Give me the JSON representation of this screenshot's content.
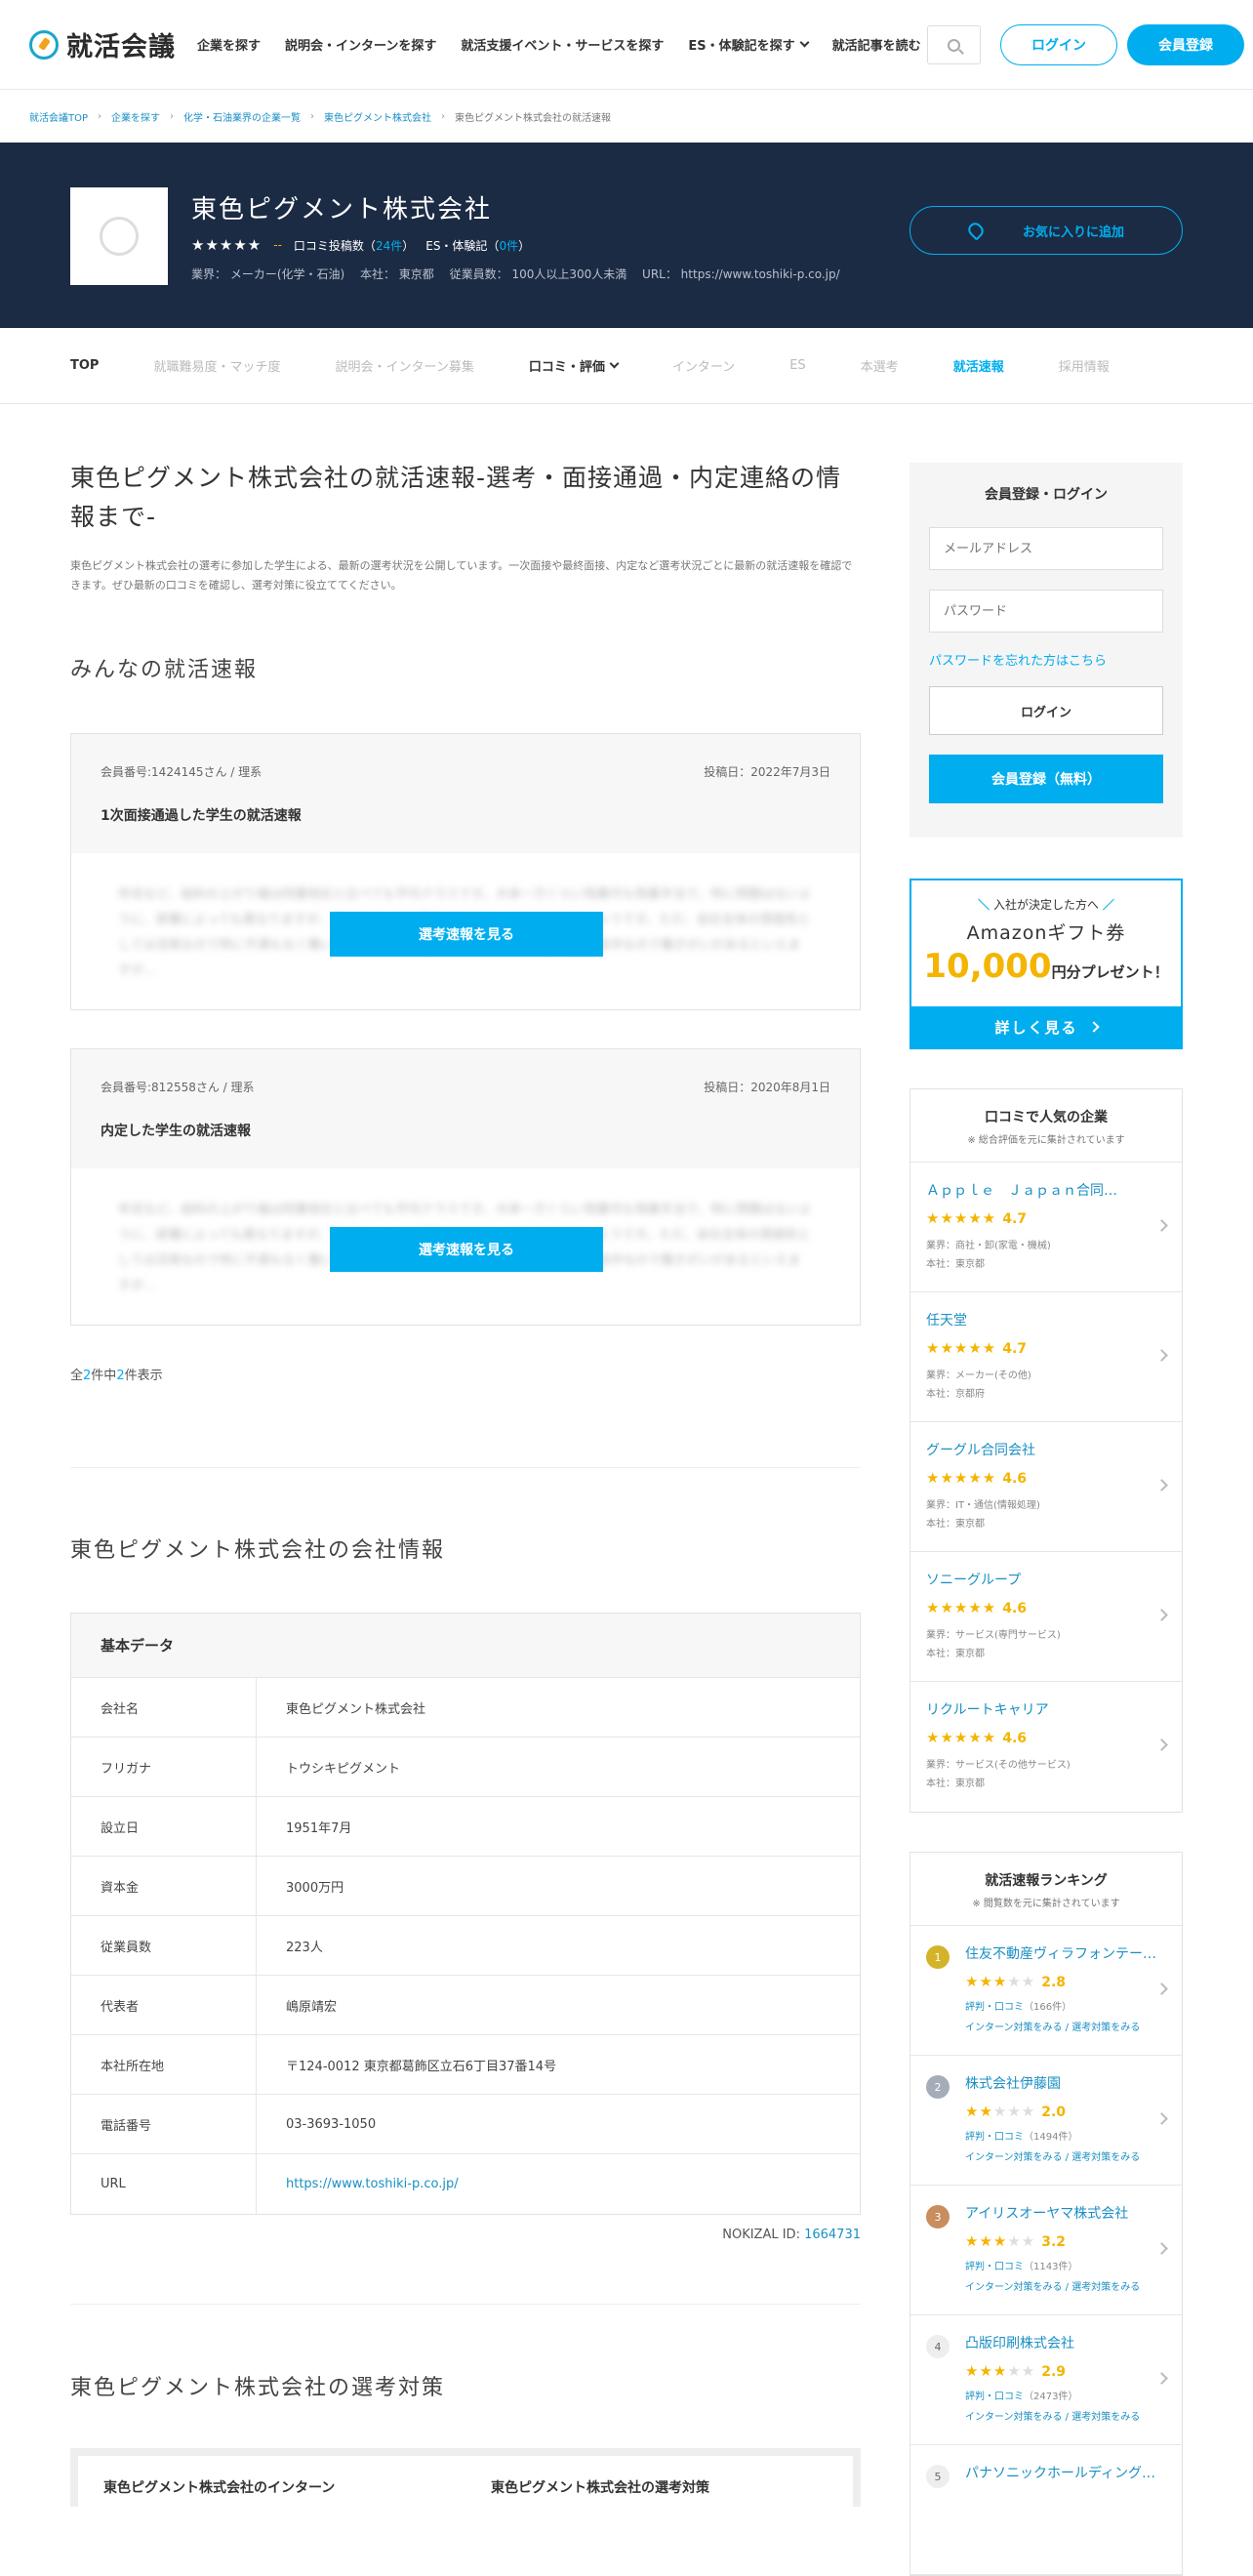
{
  "header": {
    "logo": "就活会議",
    "nav": [
      "企業を探す",
      "説明会・インターンを探す",
      "就活支援イベント・サービスを探す",
      "ES・体験記を探す",
      "就活記事を読む"
    ],
    "login": "ログイン",
    "register": "会員登録"
  },
  "breadcrumb": [
    "就活会議TOP",
    "企業を探す",
    "化学・石油業界の企業一覧",
    "東色ピグメント株式会社",
    "東色ピグメント株式会社の就活速報"
  ],
  "company": {
    "name": "東色ピグメント株式会社",
    "rating": "--",
    "reviews_label": "口コミ投稿数（",
    "reviews_count": "24件",
    "reviews_close": "）",
    "es_label": "ES・体験記（",
    "es_count": "0件",
    "es_close": "）",
    "info": "業界： メーカー(化学・石油)　 本社： 東京都　 従業員数： 100人以上300人未満　 URL： https://www.toshiki-p.co.jp/",
    "fav": "お気に入りに追加"
  },
  "tabs": [
    "TOP",
    "就職難易度・マッチ度",
    "説明会・インターン募集",
    "口コミ・評価",
    "インターン",
    "ES",
    "本選考",
    "就活速報",
    "採用情報"
  ],
  "page": {
    "title": "東色ピグメント株式会社の就活速報-選考・面接通過・内定連絡の情報まで-",
    "intro": "東色ピグメント株式会社の選考に参加した学生による、最新の選考状況を公開しています。一次面接や最終面接、内定など選考状況ごとに最新の就活速報を確認できます。ぜひ最新の口コミを確認し、選考対策に役立ててください。",
    "section1": "みんなの就活速報",
    "blur_text": "年収など、給料の上がり幅は同業他社と比べても平均クラスです。大体一万くらい残業代も残業手当で、特に問題はないように、部署によっても異なりますが、自分のペースで昇給できるというわけではないようです。ただ、会社全体の雰囲気としては活発なので特に不満もなく働いております。またスタートアップで事業も急成長中なので働きがいがあるといえますが…",
    "view_btn": "選考速報を見る",
    "count_prefix": "全",
    "count_total": "2",
    "count_mid": "件中",
    "count_shown": "2",
    "count_suffix": "件表示",
    "section2": "東色ピグメント株式会社の会社情報",
    "section3": "東色ピグメント株式会社の選考対策",
    "nokizal_label": "NOKIZAL ID:",
    "nokizal_id": "1664731",
    "box_left": "東色ピグメント株式会社のインターン",
    "box_right": "東色ピグメント株式会社の選考対策"
  },
  "reports": [
    {
      "member": "会員番号:1424145さん / 理系",
      "date": "投稿日：2022年7月3日",
      "title": "1次面接通過した学生の就活速報"
    },
    {
      "member": "会員番号:812558さん / 理系",
      "date": "投稿日：2020年8月1日",
      "title": "内定した学生の就活速報"
    }
  ],
  "basic": {
    "heading": "基本データ",
    "rows": [
      {
        "k": "会社名",
        "v": "東色ピグメント株式会社"
      },
      {
        "k": "フリガナ",
        "v": "トウシキピグメント"
      },
      {
        "k": "設立日",
        "v": "1951年7月"
      },
      {
        "k": "資本金",
        "v": "3000万円"
      },
      {
        "k": "従業員数",
        "v": "223人"
      },
      {
        "k": "代表者",
        "v": "嶋原靖宏"
      },
      {
        "k": "本社所在地",
        "v": "〒124-0012 東京都葛飾区立石6丁目37番14号"
      },
      {
        "k": "電話番号",
        "v": "03-3693-1050"
      },
      {
        "k": "URL",
        "v": "https://www.toshiki-p.co.jp/"
      }
    ]
  },
  "login_box": {
    "title": "会員登録・ログイン",
    "email_ph": "メールアドレス",
    "pw_ph": "パスワード",
    "forgot": "パスワードを忘れた方はこちら",
    "login": "ログイン",
    "register": "会員登録（無料）"
  },
  "amazon": {
    "top": "入社が決定した方へ",
    "main": "Amazonギフト券",
    "price": "10,000",
    "price_suffix": "円分プレゼント！",
    "btn": "詳しく見る"
  },
  "popular": {
    "title": "口コミで人気の企業",
    "sub": "※ 総合評価を元に集計されています",
    "items": [
      {
        "name": "Ａｐｐｌｅ　Ｊａｐａｎ合同会社",
        "rating": "4.7",
        "industry": "業界：商社・卸(家電・機械)",
        "hq": "本社：東京都"
      },
      {
        "name": "任天堂",
        "rating": "4.7",
        "industry": "業界：メーカー(その他)",
        "hq": "本社：京都府"
      },
      {
        "name": "グーグル合同会社",
        "rating": "4.6",
        "industry": "業界：IT・通信(情報処理)",
        "hq": "本社：東京都"
      },
      {
        "name": "ソニーグループ",
        "rating": "4.6",
        "industry": "業界：サービス(専門サービス)",
        "hq": "本社：東京都"
      },
      {
        "name": "リクルートキャリア",
        "rating": "4.6",
        "industry": "業界：サービス(その他サービス)",
        "hq": "本社：東京都"
      }
    ]
  },
  "ranking": {
    "title": "就活速報ランキング",
    "sub": "※ 閲覧数を元に集計されています",
    "items": [
      {
        "rank": "1",
        "color": "#d4b32a",
        "name": "住友不動産ヴィラフォンテーヌ株式会社",
        "rating": "2.8",
        "stars": 3,
        "reviews": "（166件）",
        "links": "インターン対策をみる / 選考対策をみる"
      },
      {
        "rank": "2",
        "color": "#a4adb8",
        "name": "株式会社伊藤園",
        "rating": "2.0",
        "stars": 2,
        "reviews": "（1494件）",
        "links": "インターン対策をみる / 選考対策をみる"
      },
      {
        "rank": "3",
        "color": "#c98d5e",
        "name": "アイリスオーヤマ株式会社",
        "rating": "3.2",
        "stars": 3,
        "reviews": "（1143件）",
        "links": "インターン対策をみる / 選考対策をみる"
      },
      {
        "rank": "4",
        "color": "#eeeeee",
        "name": "凸版印刷株式会社",
        "rating": "2.9",
        "stars": 3,
        "reviews": "（2473件）",
        "links": "インターン対策をみる / 選考対策をみる"
      },
      {
        "rank": "5",
        "color": "#eeeeee",
        "name": "パナソニックホールディングス株式会社",
        "rating": "",
        "stars": 0,
        "reviews": "",
        "links": ""
      }
    ],
    "review_label": "評判・口コミ"
  }
}
